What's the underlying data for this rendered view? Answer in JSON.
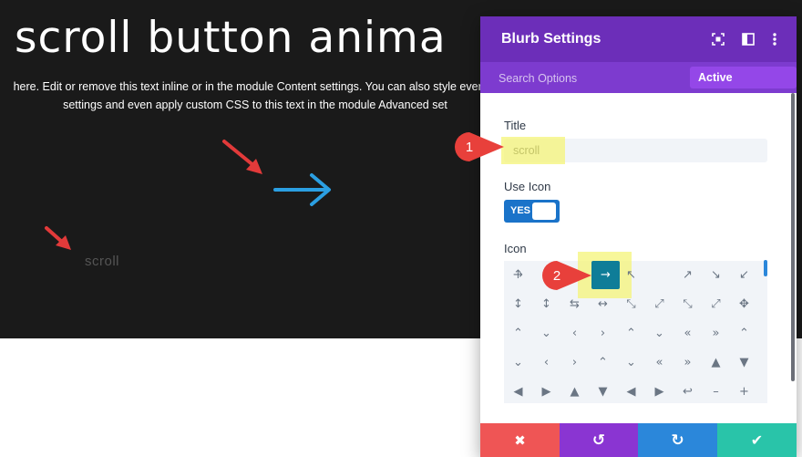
{
  "hero": {
    "title": "scroll button anima",
    "body_line1": "here. Edit or remove this text inline or in the module Content settings. You can also style every a",
    "body_line2": "settings and even apply custom CSS to this text in the module Advanced set",
    "blurb_title": "scroll",
    "blurb_icon": "right-arrow-icon",
    "blurb_icon_color": "#2b9fe2",
    "background": "#1a1a1a"
  },
  "panel": {
    "title": "Blurb Settings",
    "header_icons": [
      "fullscreen-icon",
      "sidebar-layout-icon",
      "more-vertical-icon"
    ],
    "search_placeholder": "Search Options",
    "active_filter": "Active Content",
    "active_filter_close": "✖",
    "title_label": "Title",
    "title_value": "scroll",
    "use_icon_label": "Use Icon",
    "use_icon_value": "YES",
    "icon_label": "Icon",
    "selected_icon": "→",
    "icons": [
      "↑",
      "→",
      "↖",
      "↗",
      "↘",
      "↙",
      "↕",
      "↕",
      "⇆",
      "↔",
      "⤡",
      "⤢",
      "⤡",
      "⤢",
      "✥",
      "⌃",
      "⌄",
      "‹",
      "›",
      "⌃",
      "⌄",
      "«",
      "»",
      "⌃",
      "⌄",
      "‹",
      "›",
      "⌃",
      "⌄",
      "«",
      "»",
      "▲",
      "▼",
      "◀",
      "▶",
      "▲",
      "▼",
      "◀",
      "▶",
      "↩",
      "–",
      "+",
      "×"
    ],
    "footer": {
      "cancel": "✖",
      "undo": "↺",
      "redo": "↻",
      "save": "✔"
    },
    "colors": {
      "header": "#6c2eb9",
      "subheader": "#7d3bcf",
      "active_pill": "#9447e8",
      "toggle": "#1a73c9",
      "selected_icon": "#0f7d98",
      "cancel": "#ef5555",
      "undo": "#8a35d2",
      "redo": "#2b87da",
      "save": "#29c4a9"
    }
  },
  "annotations": {
    "badge1": "1",
    "badge2": "2",
    "badge_color": "#e8403b"
  }
}
